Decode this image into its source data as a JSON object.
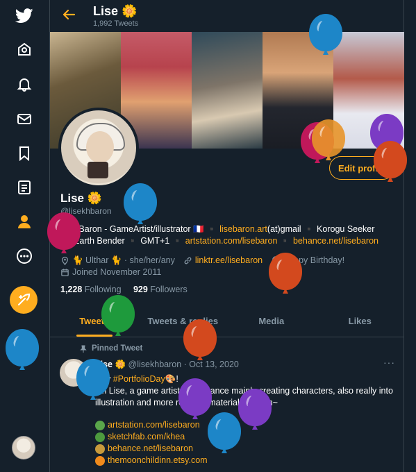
{
  "header": {
    "name": "Lise 🌼",
    "tweet_count": "1,992 Tweets"
  },
  "profile": {
    "name": "Lise 🌼",
    "handle": "@lisekhbaron",
    "edit_label": "Edit profile",
    "bio_1a": "Lise Baron - GameArtist/illustrator 🇫🇷 ▪️ ",
    "bio_1b": "lisebaron.art",
    "bio_1c": "(at)gmail ▪️ Korogu Seeker",
    "bio_2a": "✨ Earth Bender ▪️ GMT+1 ▪️ ",
    "bio_2b": "artstation.com/lisebaron",
    "bio_2c": " ▪️ ",
    "bio_2d": "behance.net/lisebaron",
    "location": "🐈 Ulthar 🐈 · she/her/any",
    "link": "linktr.ee/lisebaron",
    "birthday": "Happy Birthday!",
    "joined": "Joined November 2011",
    "following_count": "1,228",
    "following_label": "Following",
    "followers_count": "929",
    "followers_label": "Followers"
  },
  "tabs": [
    "Tweets",
    "Tweets & replies",
    "Media",
    "Likes"
  ],
  "tweet": {
    "pinned_label": "Pinned Tweet",
    "author": "Lise 🌼",
    "meta": "@lisekhbaron · Oct 13, 2020",
    "more": "···",
    "line1a": "Hey ",
    "line1b": "#PortfolioDay",
    "line1c": "🎨!",
    "line2": "I'm Lise, a game artist from France mainly creating characters, also really into illustration and more recently material creation~",
    "links": [
      "artstation.com/lisebaron",
      "sketchfab.com/khea",
      "behance.net/lisebaron",
      "themoonchildinn.etsy.com"
    ]
  },
  "icons": [
    "twitter-logo-icon",
    "home-icon",
    "bell-icon",
    "mail-icon",
    "bookmark-icon",
    "list-icon",
    "profile-icon",
    "more-icon",
    "compose-icon",
    "back-arrow-icon",
    "location-icon",
    "link-icon",
    "balloon-icon",
    "calendar-icon",
    "pin-icon"
  ],
  "colors": {
    "accent": "#ffad1f",
    "background": "#15202b",
    "muted": "#8899a6",
    "border": "#38444d"
  }
}
